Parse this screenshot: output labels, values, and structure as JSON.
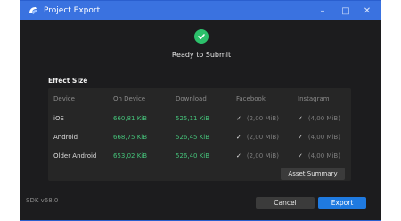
{
  "window": {
    "title": "Project Export",
    "accent": "#3a72e0"
  },
  "status": {
    "message": "Ready to Submit",
    "icon": "check-icon",
    "color": "#2cc06b"
  },
  "section": {
    "title": "Effect Size"
  },
  "table": {
    "headers": [
      "Device",
      "On Device",
      "Download",
      "Facebook",
      "Instagram"
    ],
    "rows": [
      {
        "device": "iOS",
        "on_device": "660,81 KiB",
        "download": "525,11 KiB",
        "facebook": "(2,00 MiB)",
        "instagram": "(4,00 MiB)"
      },
      {
        "device": "Android",
        "on_device": "668,75 KiB",
        "download": "526,45 KiB",
        "facebook": "(2,00 MiB)",
        "instagram": "(4,00 MiB)"
      },
      {
        "device": "Older Android",
        "on_device": "653,02 KiB",
        "download": "526,40 KiB",
        "facebook": "(2,00 MiB)",
        "instagram": "(4,00 MiB)"
      }
    ]
  },
  "buttons": {
    "asset_summary": "Asset Summary",
    "cancel": "Cancel",
    "export": "Export"
  },
  "footer": {
    "sdk": "SDK v68.0"
  }
}
